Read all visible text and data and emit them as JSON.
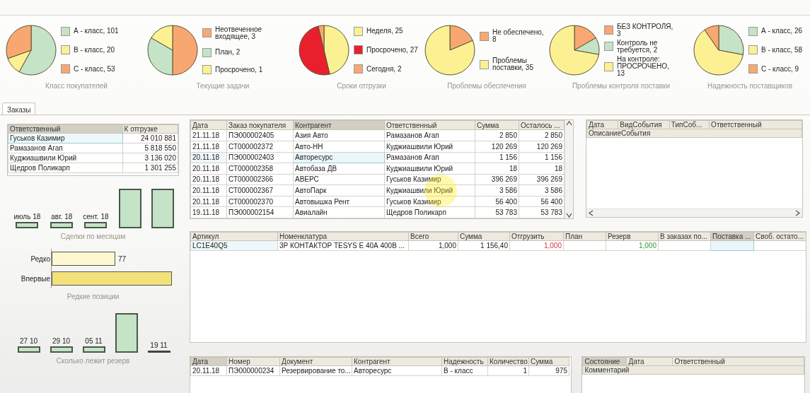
{
  "pies": [
    {
      "chart_data": {
        "type": "pie",
        "title": "Класс покупателей",
        "categories": [
          "А - класс, 101",
          "В - класс, 20",
          "С - класс, 53"
        ],
        "values": [
          101,
          20,
          53
        ],
        "colors": [
          "#c5e3c6",
          "#fbf193",
          "#f9a771"
        ]
      }
    },
    {
      "chart_data": {
        "type": "pie",
        "title": "Текущие задачи",
        "categories": [
          "Неотвеченное входящее, 3",
          "План, 2",
          "Просрочено, 1"
        ],
        "values": [
          3,
          2,
          1
        ],
        "colors": [
          "#f9a771",
          "#c5e3c6",
          "#fbf193"
        ]
      }
    },
    {
      "chart_data": {
        "type": "pie",
        "title": "Сроки отгрузки",
        "categories": [
          "Неделя, 25",
          "Просрочено, 27",
          "Сегодня, 2"
        ],
        "values": [
          25,
          27,
          2
        ],
        "colors": [
          "#fbf193",
          "#e8202e",
          "#f9a771"
        ]
      }
    },
    {
      "chart_data": {
        "type": "pie",
        "title": "Проблемы обеспечения",
        "categories": [
          "Не обеспечено, 8",
          "Проблемы поставки, 35"
        ],
        "values": [
          8,
          35
        ],
        "colors": [
          "#f9a771",
          "#fbf193"
        ]
      }
    },
    {
      "chart_data": {
        "type": "pie",
        "title": "Проблемы контроля поставки",
        "categories": [
          "БЕЗ КОНТРОЛЯ, 3",
          "Контроль не требуется, 2",
          "На контроле: ПРОСРОЧЕНО, 13"
        ],
        "values": [
          3,
          2,
          13
        ],
        "colors": [
          "#f9a771",
          "#c5e3c6",
          "#fbf193"
        ]
      }
    },
    {
      "chart_data": {
        "type": "pie",
        "title": "Надежность поставщиков",
        "categories": [
          "А - класс, 26",
          "В - класс, 58",
          "С - класс, 9"
        ],
        "values": [
          26,
          58,
          9
        ],
        "colors": [
          "#c5e3c6",
          "#fbf193",
          "#f9a771"
        ]
      }
    }
  ],
  "tabs": [
    {
      "label": "Заказы",
      "selected": true
    }
  ],
  "responsible_table": {
    "columns": [
      {
        "label": "Ответственный",
        "kind": "text",
        "selected": true
      },
      {
        "label": "К отгрузке",
        "kind": "number",
        "selected": false
      }
    ],
    "rows": [
      {
        "cells": [
          "Гуськов Казимир",
          "24 010 881"
        ],
        "selected": true
      },
      {
        "cells": [
          "Рамазанов Агап",
          "5 818 550"
        ],
        "selected": false
      },
      {
        "cells": [
          "Куджиашвили Юрий",
          "3 136 020"
        ],
        "selected": false
      },
      {
        "cells": [
          "Щедров Поликарп",
          "1 301 255"
        ],
        "selected": false
      }
    ]
  },
  "deals_chart": {
    "title": "Сделки по месяцам",
    "bars": [
      {
        "kind": "low",
        "label": "июль 18"
      },
      {
        "kind": "low",
        "label": "авг. 18"
      },
      {
        "kind": "low",
        "label": "сент. 18"
      },
      {
        "kind": "high"
      },
      {
        "kind": "high"
      }
    ]
  },
  "rare_chart": {
    "title": "Редкие позиции",
    "bars": [
      {
        "kind": "short",
        "label": "Редко",
        "value_label": "77",
        "color": "#fdf8d2"
      },
      {
        "kind": "long",
        "label": "Впервые",
        "color": "#f3e17a"
      }
    ]
  },
  "reserve_chart": {
    "title": "Сколько лежит резерв",
    "bars": [
      {
        "kind": "low",
        "label": "27 10"
      },
      {
        "kind": "low",
        "label": "29 10"
      },
      {
        "kind": "low",
        "label": "05 11"
      },
      {
        "kind": "high"
      },
      {
        "kind": "flat",
        "label": "19 11"
      }
    ]
  },
  "orders_table": {
    "columns": [
      {
        "label": "Дата",
        "kind": "text",
        "selected": false
      },
      {
        "label": "Заказ покупателя",
        "kind": "text",
        "selected": false
      },
      {
        "label": "Контрагент",
        "kind": "text",
        "selected": true
      },
      {
        "label": "Ответственный",
        "kind": "text",
        "selected": false
      },
      {
        "label": "Сумма",
        "kind": "number",
        "selected": false
      },
      {
        "label": "Осталось ...",
        "kind": "number",
        "selected": false
      }
    ],
    "rows": [
      {
        "cells": [
          "21.11.18",
          "ПЭ000002405",
          "Азия Авто",
          "Рамазанов Агап",
          "2 850",
          "2 850"
        ],
        "selected": false
      },
      {
        "cells": [
          "21.11.18",
          "СТ000002372",
          "Авто-НН",
          "Куджиашвили Юрий",
          "120 269",
          "120 269"
        ],
        "selected": false
      },
      {
        "cells": [
          "20.11.18",
          "ПЭ000002403",
          "Авторесурс",
          "Рамазанов Агап",
          "1 156",
          "1 156"
        ],
        "selected": true
      },
      {
        "cells": [
          "20.11.18",
          "СТ000002358",
          "Автобаза ДВ",
          "Куджиашвили Юрий",
          "18",
          "18"
        ],
        "selected": false
      },
      {
        "cells": [
          "20.11.18",
          "СТ000002366",
          "АВЕРС",
          "Гуськов Казимир",
          "396 269",
          "396 269"
        ],
        "selected": false
      },
      {
        "cells": [
          "20.11.18",
          "СТ000002367",
          "АвтоПарк",
          "Куджиашвили Юрий",
          "3 586",
          "3 586"
        ],
        "selected": false
      },
      {
        "cells": [
          "20.11.18",
          "СТ000002370",
          "Автовышка Рент",
          "Гуськов Казимир",
          "56 400",
          "56 400"
        ],
        "selected": false
      },
      {
        "cells": [
          "19.11.18",
          "ПЭ000002154",
          "Авиалайн",
          "Щедров Поликарп",
          "53 783",
          "53 783"
        ],
        "selected": false
      }
    ]
  },
  "events_table": {
    "columns": [
      {
        "label": "Дата",
        "selected": false
      },
      {
        "label": "ВидСобытия",
        "selected": false
      },
      {
        "label": "ТипСоб...",
        "selected": false
      },
      {
        "label": "Ответственный",
        "selected": false
      }
    ],
    "subcolumns": [
      "ОписаниеСобытия"
    ]
  },
  "items_table": {
    "columns": [
      {
        "label": "Артикул",
        "kind": "text",
        "selected": false
      },
      {
        "label": "Номенклатура",
        "kind": "text",
        "selected": false
      },
      {
        "label": "Всего",
        "kind": "number",
        "selected": false
      },
      {
        "label": "Сумма",
        "kind": "number",
        "selected": false
      },
      {
        "label": "Отгрузить",
        "kind": "shortage",
        "selected": false
      },
      {
        "label": "План",
        "kind": "number",
        "selected": false
      },
      {
        "label": "Резерв",
        "kind": "reserved",
        "selected": false
      },
      {
        "label": "В заказах по...",
        "kind": "number",
        "selected": false
      },
      {
        "label": "Поставка ...",
        "kind": "number",
        "selected": true
      },
      {
        "label": "Своб. остато...",
        "kind": "number",
        "selected": false
      }
    ],
    "rows": [
      {
        "cells": [
          "LC1E40Q5",
          "3Р КОНТАКТОР TESYS E 40А 400В ...",
          "1,000",
          "1 156,40",
          "1,000",
          "",
          "1,000",
          "",
          "",
          ""
        ],
        "selected": true
      }
    ]
  },
  "reserve_table": {
    "columns": [
      {
        "label": "Дата",
        "kind": "text",
        "selected": true
      },
      {
        "label": "Номер",
        "kind": "text",
        "selected": false
      },
      {
        "label": "Документ",
        "kind": "text",
        "selected": false
      },
      {
        "label": "Контрагент",
        "kind": "text",
        "selected": false
      },
      {
        "label": "Надежность",
        "kind": "text",
        "selected": false
      },
      {
        "label": "Количество",
        "kind": "number",
        "selected": false
      },
      {
        "label": "Сумма",
        "kind": "number",
        "selected": false
      }
    ],
    "rows": [
      {
        "cells": [
          "20.11.18",
          "ПЭ000000234",
          "Резервирование то...",
          "Авторесурс",
          "В - класс",
          "1",
          "975"
        ],
        "selected": false
      }
    ]
  },
  "state_table": {
    "columns": [
      {
        "label": "Состояние",
        "selected": true
      },
      {
        "label": "Дата",
        "selected": false
      },
      {
        "label": "Ответственный",
        "selected": false
      }
    ],
    "subcolumns": [
      "Комментарий"
    ]
  }
}
